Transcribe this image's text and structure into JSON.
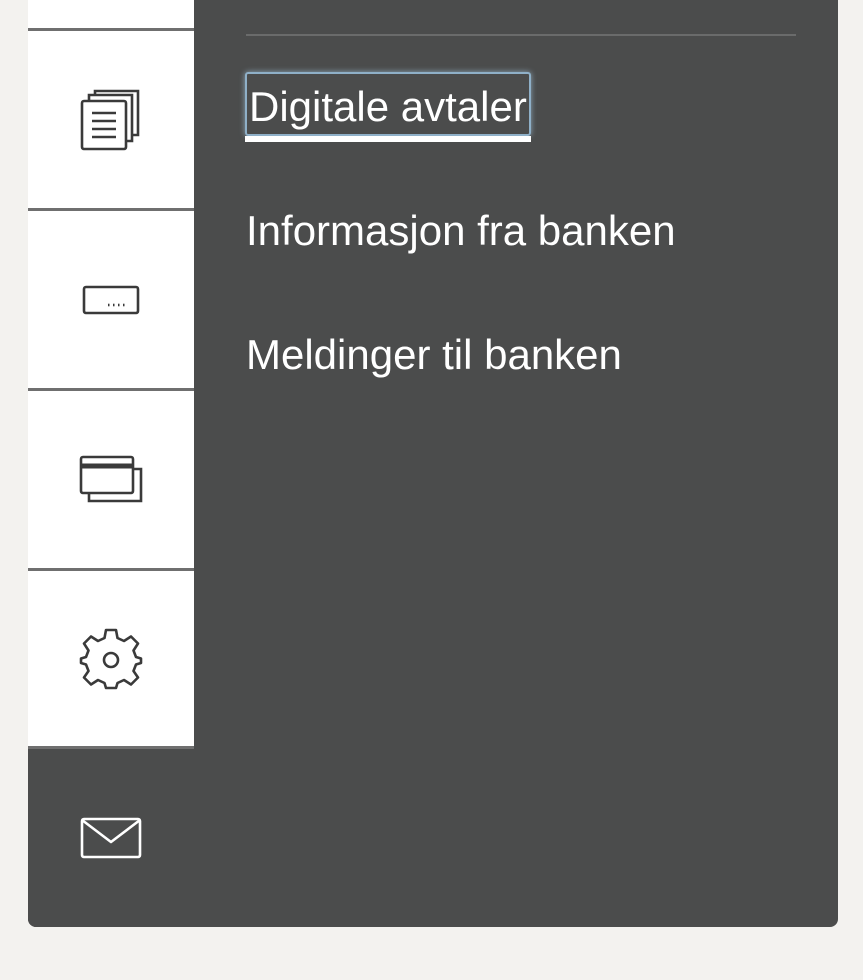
{
  "nav_rail": {
    "items": [
      {
        "name": "documents-icon",
        "label": ""
      },
      {
        "name": "keyboard-icon",
        "label": ""
      },
      {
        "name": "credit-card-icon",
        "label": ""
      },
      {
        "name": "settings-icon",
        "label": ""
      },
      {
        "name": "mail-icon",
        "label": "",
        "active": true
      }
    ]
  },
  "submenu": {
    "items": [
      {
        "label": "Digitale avtaler",
        "focused": true
      },
      {
        "label": "Informasjon fra banken"
      },
      {
        "label": "Meldinger til banken"
      }
    ]
  },
  "colors": {
    "panel": "#4b4c4c",
    "rail_bg": "#ffffff",
    "page_bg": "#f3f2ef",
    "focus_ring": "#8fb0c8",
    "text": "#ffffff"
  }
}
